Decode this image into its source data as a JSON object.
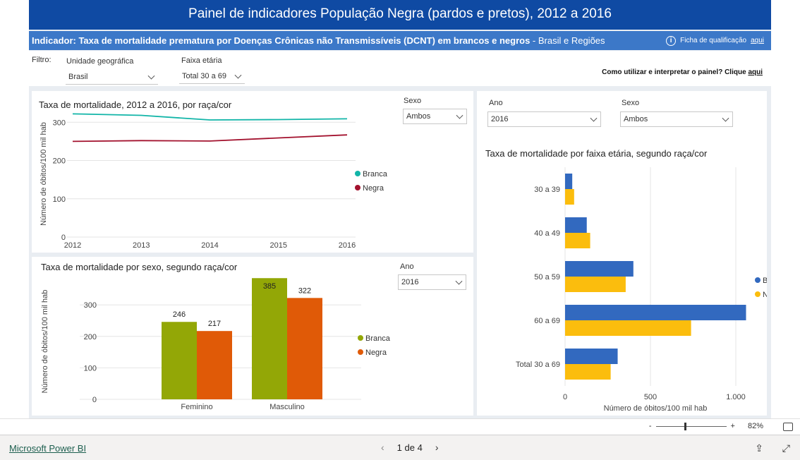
{
  "title": "Painel de indicadores População Negra (pardos e pretos), 2012 a 2016",
  "indicator": {
    "bold": "Indicador: Taxa de mortalidade prematura por Doenças Crônicas não Transmissíveis (DCNT) em brancos e negros",
    "sep": " - ",
    "scope": "Brasil e Regiões",
    "ficha_label": "Ficha de qualificação",
    "ficha_link": "aqui",
    "info_icon": "i"
  },
  "filters": {
    "label": "Filtro:",
    "geo_label": "Unidade geográfica",
    "geo_value": "Brasil",
    "age_label": "Faixa etária",
    "age_value": "Total 30 a 69",
    "help_text": "Como utilizar e interpretar o painel? Clique",
    "help_link": "aqui"
  },
  "panel_line": {
    "title": "Taxa de mortalidade, 2012 a 2016, por raça/cor",
    "sexo_label": "Sexo",
    "sexo_value": "Ambos"
  },
  "panel_sex": {
    "title": "Taxa de mortalidade por sexo, segundo raça/cor",
    "ano_label": "Ano",
    "ano_value": "2016"
  },
  "panel_age": {
    "ano_label": "Ano",
    "ano_value": "2016",
    "sexo_label": "Sexo",
    "sexo_value": "Ambos",
    "title": "Taxa de mortalidade por faixa etária, segundo raça/cor"
  },
  "chart_data": [
    {
      "type": "line",
      "title": "Taxa de mortalidade, 2012 a 2016, por raça/cor",
      "x": [
        "2012",
        "2013",
        "2014",
        "2015",
        "2016"
      ],
      "ylabel": "Número de óbitos/100 mil hab",
      "yticks": [
        "0",
        "100",
        "200",
        "300"
      ],
      "ylim": [
        0,
        330
      ],
      "series": [
        {
          "name": "Branca",
          "color": "#12b5a8",
          "values": [
            322,
            318,
            306,
            307,
            309
          ]
        },
        {
          "name": "Negra",
          "color": "#a3122e",
          "values": [
            250,
            252,
            251,
            259,
            267
          ]
        }
      ],
      "legend": "right"
    },
    {
      "type": "bar",
      "title": "Taxa de mortalidade por sexo, segundo raça/cor",
      "categories": [
        "Feminino",
        "Masculino"
      ],
      "ylabel": "Número de óbitos/100 mil hab",
      "yticks": [
        "0",
        "100",
        "200",
        "300"
      ],
      "ylim": [
        0,
        390
      ],
      "series": [
        {
          "name": "Branca",
          "color": "#93a706",
          "values": [
            246,
            385
          ],
          "labels": [
            "246",
            "385"
          ]
        },
        {
          "name": "Negra",
          "color": "#e05a07",
          "values": [
            217,
            322
          ],
          "labels": [
            "217",
            "322"
          ]
        }
      ],
      "legend": "right"
    },
    {
      "type": "bar",
      "orientation": "horizontal",
      "title": "Taxa de mortalidade por faixa etária, segundo raça/cor",
      "categories": [
        "30 a 39",
        "40 a 49",
        "50 a 59",
        "60 a 69",
        "Total 30 a 69"
      ],
      "xlabel": "Número de óbitos/100 mil hab",
      "xticks": [
        "0",
        "500",
        "1.000"
      ],
      "xlim": [
        0,
        1100
      ],
      "series": [
        {
          "name": "Branca",
          "color": "#3269bf",
          "values": [
            42,
            127,
            400,
            1060,
            308
          ]
        },
        {
          "name": "Negra",
          "color": "#fbbd0d",
          "values": [
            53,
            147,
            355,
            738,
            267
          ]
        }
      ],
      "legend": "right"
    }
  ],
  "footer": {
    "brand": "Microsoft Power BI",
    "page": "1 de 4",
    "prev": "‹",
    "next": "›",
    "zoom_minus": "-",
    "zoom_plus": "+",
    "zoom_value": "82%",
    "share_icon": "⇪",
    "expand_icon": "⤢"
  }
}
